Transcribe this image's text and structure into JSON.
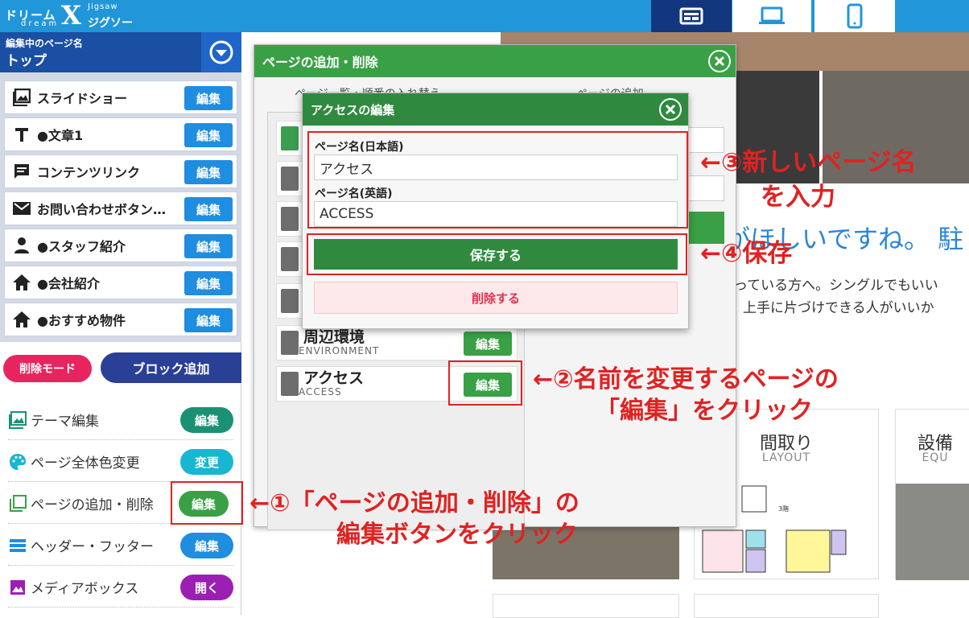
{
  "logo": {
    "line1": "ドリーム",
    "x": "X",
    "jigsaw": "Jigsaw",
    "line2": "ジグソー",
    "dream": "dream"
  },
  "sidebar": {
    "page_label": "編集中のページ名",
    "page_name": "トップ",
    "blocks": [
      {
        "label": "スライドショー",
        "icon": "image-icon",
        "action": "編集"
      },
      {
        "label": "●文章1",
        "icon": "text-icon",
        "action": "編集"
      },
      {
        "label": "コンテンツリンク",
        "icon": "message-icon",
        "action": "編集"
      },
      {
        "label": "お問い合わせボタン…",
        "icon": "mail-icon",
        "action": "編集"
      },
      {
        "label": "●スタッフ紹介",
        "icon": "person-icon",
        "action": "編集"
      },
      {
        "label": "●会社紹介",
        "icon": "home-icon",
        "action": "編集"
      },
      {
        "label": "●おすすめ物件",
        "icon": "home-icon",
        "action": "編集"
      }
    ],
    "delete_mode": "削除モード",
    "add_block": "ブロック追加",
    "options": [
      {
        "label": "テーマ編集",
        "action": "編集",
        "color": "#1a9174"
      },
      {
        "label": "ページ全体色変更",
        "action": "変更",
        "color": "#17b6d1"
      },
      {
        "label": "ページの追加・削除",
        "action": "編集",
        "color": "#3aa046"
      },
      {
        "label": "ヘッダー・フッター",
        "action": "編集",
        "color": "#1f8de0"
      },
      {
        "label": "メディアボックス",
        "action": "開く",
        "color": "#9c1fb5"
      }
    ]
  },
  "preview": {
    "headline": "がほしいですね。 駐",
    "line1": "っている方へ。シングルでもいい",
    "line2": "上手に片づけできる人がいいか",
    "cards": [
      {
        "title": "間取り",
        "sub": "LAYOUT"
      },
      {
        "title": "設備",
        "sub": "EQU"
      }
    ]
  },
  "page_dialog": {
    "title": "ページの追加・削除",
    "subtab1": "ページ一覧・順番の入れ替え",
    "subtab2": "ページの追加",
    "pages": [
      {
        "name": "周辺環境",
        "en": "ENVIRONMENT",
        "action": "編集"
      },
      {
        "name": "アクセス",
        "en": "ACCESS",
        "action": "編集"
      }
    ]
  },
  "edit_dialog": {
    "title": "アクセスの編集",
    "jp_label": "ページ名(日本語)",
    "jp_value": "アクセス",
    "en_label": "ページ名(英語)",
    "en_value": "ACCESS",
    "save": "保存する",
    "delete": "削除する"
  },
  "annotations": {
    "a1_line1": "←①「ページの追加・削除」の",
    "a1_line2": "編集ボタンをクリック",
    "a2_line1": "←②名前を変更するページの",
    "a2_line2": "「編集」をクリック",
    "a3_line1": "←③新しいページ名",
    "a3_line2": "を入力",
    "a4": "←④保存"
  },
  "colors": {
    "accent_red": "#e02222",
    "topbar": "#2196d9",
    "green": "#3aa046"
  }
}
